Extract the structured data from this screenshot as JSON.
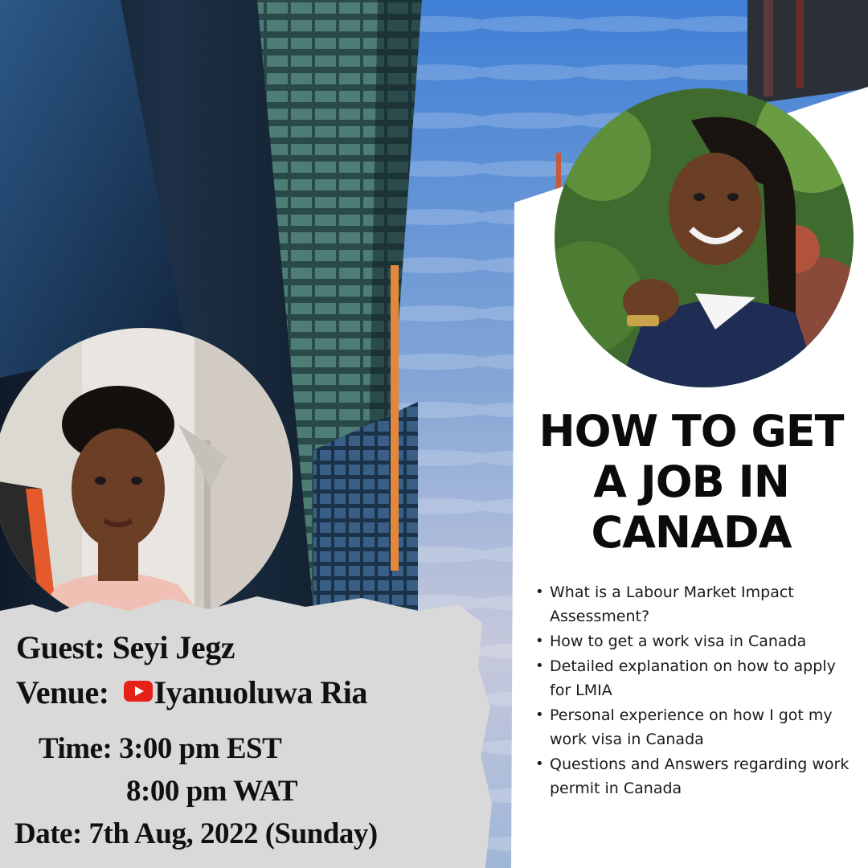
{
  "headline": [
    "HOW TO GET",
    "A JOB IN",
    "CANADA"
  ],
  "topics": [
    "What is a Labour Market Impact Assessment?",
    "How to get a work visa in Canada",
    "Detailed explanation on how to apply for LMIA",
    "Personal experience on how I got my work visa in Canada",
    "Questions and Answers regarding work permit in Canada"
  ],
  "guest": {
    "text": "Guest: Seyi Jegz"
  },
  "venue": {
    "label": "Venue:",
    "channel": "Iyanuoluwa Ria",
    "icon": "youtube-icon"
  },
  "time": {
    "line1": "Time: 3:00 pm EST",
    "line2": "8:00 pm WAT"
  },
  "date": {
    "text": "Date: 7th Aug, 2022 (Sunday)"
  },
  "colors": {
    "youtube_red": "#e62117",
    "panel_white": "#ffffff",
    "brush_gray": "#d9d9d9"
  }
}
